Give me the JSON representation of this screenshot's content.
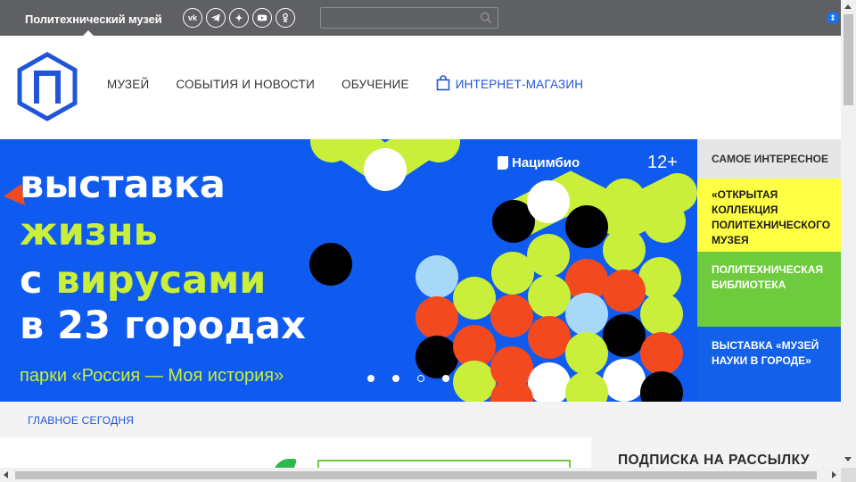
{
  "topbar": {
    "brand": "Политехнический музей",
    "socials": [
      {
        "name": "vk-icon",
        "glyph": "vk"
      },
      {
        "name": "telegram-icon",
        "glyph": ""
      },
      {
        "name": "zen-icon",
        "glyph": ""
      },
      {
        "name": "youtube-icon",
        "glyph": ""
      },
      {
        "name": "odnoklassniki-icon",
        "glyph": ""
      }
    ],
    "search_placeholder": ""
  },
  "nav": {
    "museum": "МУЗЕЙ",
    "events": "СОБЫТИЯ И НОВОСТИ",
    "education": "ОБУЧЕНИЕ",
    "shop": "ИНТЕРНЕТ-МАГАЗИН"
  },
  "hero": {
    "line1": "выставка",
    "line2": "жизнь",
    "line3_a": "с ",
    "line3_b": "вирусами",
    "line4": "в 23 городах",
    "line5": "парки «Россия — Моя история»",
    "sponsor": "Нацимбио",
    "age": "12+",
    "slide_count": 4,
    "active_slide": 3
  },
  "side": {
    "header": "САМОЕ ИНТЕРЕСНОЕ",
    "item1": "«ОТКРЫТАЯ КОЛЛЕКЦИЯ ПОЛИТЕХНИЧЕСКОГО МУЗЕЯ",
    "item2": "ПОЛИТЕХНИЧЕСКАЯ БИБЛИОТЕКА",
    "item3": "ВЫСТАВКА «МУЗЕЙ НАУКИ В ГОРОДЕ»"
  },
  "today": {
    "label": "ГЛАВНОЕ СЕГОДНЯ"
  },
  "subscribe": {
    "title": "ПОДПИСКА НА РАССЫЛКУ"
  },
  "colors": {
    "topbar": "#5f6063",
    "hero_blue": "#0f5bf0",
    "lime": "#c9ef3a",
    "yellow": "#ffff44",
    "green": "#6ecb3d",
    "link_blue": "#1f55d8"
  }
}
